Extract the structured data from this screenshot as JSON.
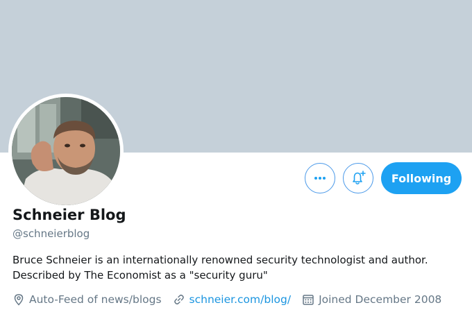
{
  "profile": {
    "name": "Schneier Blog",
    "handle": "@schneierblog",
    "bio_line1": "Bruce Schneier is an internationally renowned security technologist and author.",
    "bio_line2": "Described by The Economist as a \"security guru\"",
    "location": "Auto-Feed of news/blogs",
    "website": "schneier.com/blog/",
    "joined": "Joined December 2008"
  },
  "actions": {
    "follow_label": "Following"
  },
  "icons": {
    "more": "more-icon",
    "notification": "bell-plus-icon",
    "location": "location-pin-icon",
    "link": "link-icon",
    "calendar": "calendar-icon"
  },
  "colors": {
    "accent": "#1da1f2",
    "banner": "#c5d0d9",
    "secondary_text": "#657786",
    "link": "#1b95e0"
  }
}
